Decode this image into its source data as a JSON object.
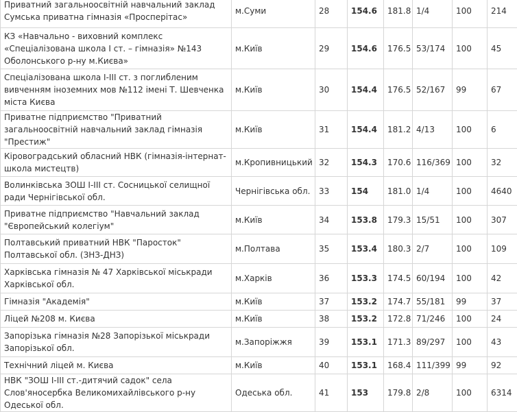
{
  "rows": [
    {
      "name": "Приватний загальноосвітній навчальний заклад Сумська приватна гімназія «Просперітас»",
      "city": "м.Суми",
      "rank": "28",
      "score": "154.6",
      "avg": "181.8",
      "ratio": "1/4",
      "pct": "100",
      "count": "214"
    },
    {
      "name": "КЗ «Навчально - виховний комплекс «Спеціалізована школа І ст. – гімназія» №143 Оболонського р-ну м.Києва»",
      "city": "м.Київ",
      "rank": "29",
      "score": "154.6",
      "avg": "176.5",
      "ratio": "53/174",
      "pct": "100",
      "count": "45"
    },
    {
      "name": "Спеціалізована школа І-ІІІ ст. з поглибленим вивченням іноземних мов №112 імені Т. Шевченка міста Києва",
      "city": "м.Київ",
      "rank": "30",
      "score": "154.4",
      "avg": "176.5",
      "ratio": "52/167",
      "pct": "99",
      "count": "67"
    },
    {
      "name": "Приватне підприємство \"Приватний загальноосвітній навчальний заклад гімназія \"Престиж\"",
      "city": "м.Київ",
      "rank": "31",
      "score": "154.4",
      "avg": "181.2",
      "ratio": "4/13",
      "pct": "100",
      "count": "6"
    },
    {
      "name": "Кіровоградський обласний НВК (гімназія-інтернат-школа мистецтв)",
      "city": "м.Кропивницький",
      "rank": "32",
      "score": "154.3",
      "avg": "170.6",
      "ratio": "116/369",
      "pct": "100",
      "count": "32"
    },
    {
      "name": "Волинківська ЗОШ І-ІІІ ст. Сосницької селищної ради Чернігівської обл.",
      "city": "Чернігівська обл.",
      "rank": "33",
      "score": "154",
      "avg": "181.0",
      "ratio": "1/4",
      "pct": "100",
      "count": "4640"
    },
    {
      "name": "Приватне підприємство \"Навчальний заклад \"Європейський колегіум\"",
      "city": "м.Київ",
      "rank": "34",
      "score": "153.8",
      "avg": "179.3",
      "ratio": "15/51",
      "pct": "100",
      "count": "307"
    },
    {
      "name": "Полтавський приватний НВК \"Паросток\" Полтавської обл. (ЗНЗ-ДНЗ)",
      "city": "м.Полтава",
      "rank": "35",
      "score": "153.4",
      "avg": "180.3",
      "ratio": "2/7",
      "pct": "100",
      "count": "109"
    },
    {
      "name": "Харківська гімназія № 47 Харківської міськради Харківської обл.",
      "city": "м.Харків",
      "rank": "36",
      "score": "153.3",
      "avg": "174.5",
      "ratio": "60/194",
      "pct": "100",
      "count": "42"
    },
    {
      "name": "Гімназія \"Академія\"",
      "city": "м.Київ",
      "rank": "37",
      "score": "153.2",
      "avg": "174.7",
      "ratio": "55/181",
      "pct": "99",
      "count": "37"
    },
    {
      "name": "Ліцей №208 м. Києва",
      "city": "м.Київ",
      "rank": "38",
      "score": "153.2",
      "avg": "172.8",
      "ratio": "71/246",
      "pct": "100",
      "count": "24"
    },
    {
      "name": "Запорізька гімназія №28 Запорізької міськради Запорізької обл.",
      "city": "м.Запоріжжя",
      "rank": "39",
      "score": "153.1",
      "avg": "171.3",
      "ratio": "89/297",
      "pct": "100",
      "count": "43"
    },
    {
      "name": "Технічний ліцей м. Києва",
      "city": "м.Київ",
      "rank": "40",
      "score": "153.1",
      "avg": "168.4",
      "ratio": "111/399",
      "pct": "99",
      "count": "92"
    },
    {
      "name": "НВК \"ЗОШ І-ІІІ ст.-дитячий садок\" села Слов'яносербка Великомихайлівського р-ну Одеської обл.",
      "city": "Одеська обл.",
      "rank": "41",
      "score": "153",
      "avg": "179.8",
      "ratio": "2/8",
      "pct": "100",
      "count": "6314"
    }
  ]
}
